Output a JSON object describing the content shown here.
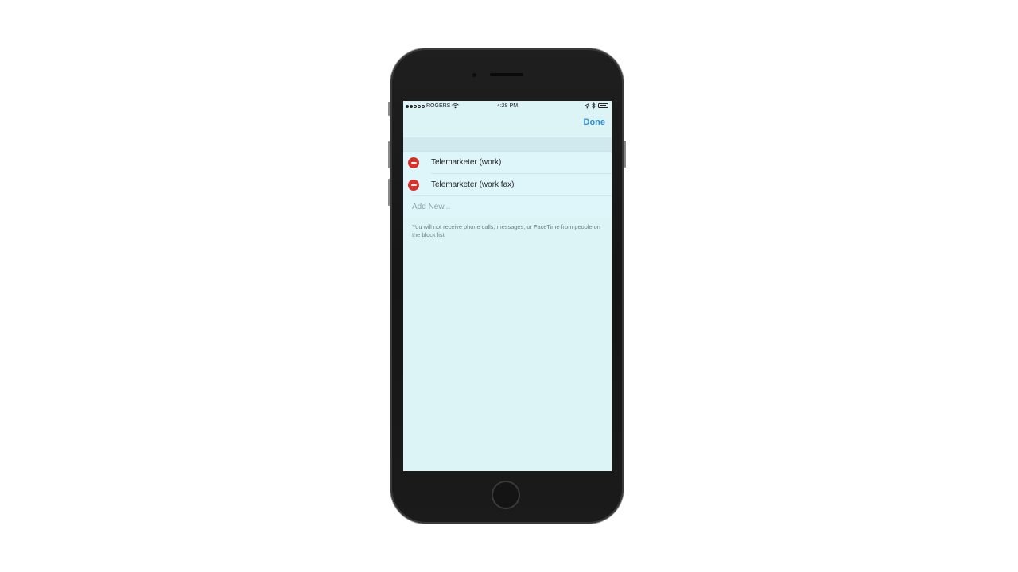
{
  "status_bar": {
    "carrier": "ROGERS",
    "time": "4:28 PM"
  },
  "nav": {
    "done_label": "Done"
  },
  "blocked_list": {
    "items": [
      {
        "label": "Telemarketer (work)"
      },
      {
        "label": "Telemarketer (work fax)"
      }
    ],
    "add_new_label": "Add New..."
  },
  "footer_note": "You will not receive phone calls, messages, or FaceTime from people on the block list.",
  "colors": {
    "accent": "#2a8fd8",
    "delete": "#d9302a",
    "screen_bg": "#ddf4f7"
  }
}
